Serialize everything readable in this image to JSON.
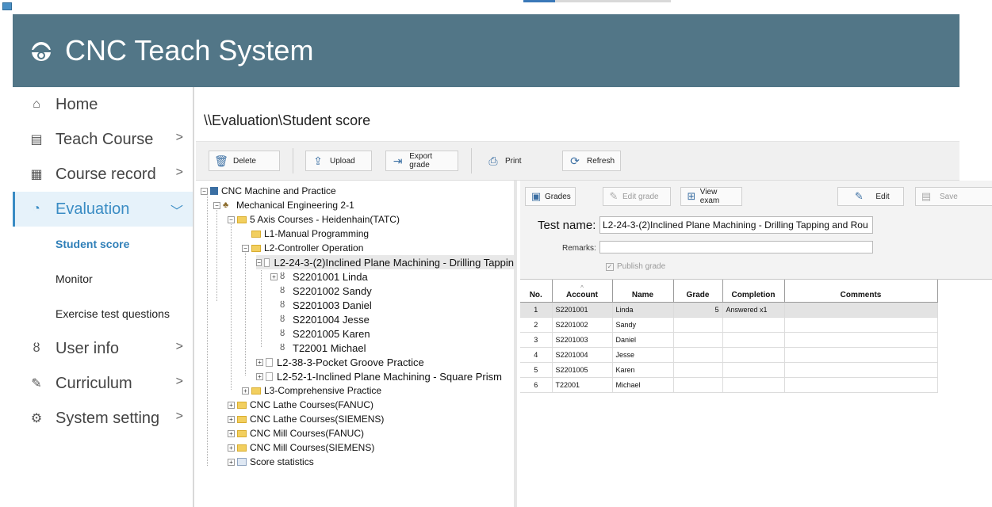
{
  "app": {
    "title": "CNC Teach System",
    "logo_icon": "hardhat-gear-icon"
  },
  "sidebar": {
    "items": [
      {
        "label": "Home",
        "icon": "home-icon",
        "has_arrow": false
      },
      {
        "label": "Teach Course",
        "icon": "monitor-icon",
        "has_arrow": true
      },
      {
        "label": "Course record",
        "icon": "document-icon",
        "has_arrow": true
      },
      {
        "label": "Evaluation",
        "icon": "pie-chart-icon",
        "has_arrow": true,
        "active": true
      },
      {
        "label": "User info",
        "icon": "user-icon",
        "has_arrow": true
      },
      {
        "label": "Curriculum",
        "icon": "pencil-icon",
        "has_arrow": true
      },
      {
        "label": "System setting",
        "icon": "gear-icon",
        "has_arrow": true
      }
    ],
    "sub_items": [
      {
        "label": "Student score",
        "active": true
      },
      {
        "label": "Monitor"
      },
      {
        "label": "Exercise test questions"
      }
    ],
    "arrow_right": ">",
    "arrow_down": "﹀"
  },
  "main": {
    "breadcrumb": "\\\\Evaluation\\Student score",
    "toolbar": {
      "delete": "Delete",
      "upload": "Upload",
      "export": "Export grade",
      "print": "Print",
      "refresh": "Refresh"
    }
  },
  "tree": {
    "nodes": [
      "CNC Machine and Practice",
      "Mechanical Engineering 2-1",
      "5 Axis Courses - Heidenhain(TATC)",
      "L1-Manual Programming",
      "L2-Controller Operation",
      "L2-24-3-(2)Inclined Plane Machining - Drilling Tappin",
      "S2201001 Linda",
      "S2201002 Sandy",
      "S2201003 Daniel",
      "S2201004 Jesse",
      "S2201005 Karen",
      "T22001 Michael",
      "L2-38-3-Pocket Groove Practice",
      "L2-52-1-Inclined Plane Machining - Square Prism",
      "L3-Comprehensive Practice",
      "CNC Lathe Courses(FANUC)",
      "CNC Lathe Courses(SIEMENS)",
      "CNC Mill Courses(FANUC)",
      "CNC Mill Courses(SIEMENS)",
      "Score statistics"
    ]
  },
  "detail": {
    "toolbar": {
      "grades": "Grades",
      "edit_grade": "Edit grade",
      "view_exam": "View exam",
      "edit": "Edit",
      "save": "Save"
    },
    "test_name_label": "Test name:",
    "test_name_value": "L2-24-3-(2)Inclined Plane Machining - Drilling Tapping and Rou",
    "remarks_label": "Remarks:",
    "remarks_value": "",
    "publish_label": "Publish grade",
    "publish_checked": true
  },
  "grid": {
    "columns": [
      "No.",
      "Account",
      "Name",
      "Grade",
      "Completion",
      "Comments"
    ],
    "rows": [
      {
        "no": "1",
        "account": "S2201001",
        "name": "Linda",
        "grade": "5",
        "completion": "Answered x1",
        "comments": ""
      },
      {
        "no": "2",
        "account": "S2201002",
        "name": "Sandy",
        "grade": "",
        "completion": "",
        "comments": ""
      },
      {
        "no": "3",
        "account": "S2201003",
        "name": "Daniel",
        "grade": "",
        "completion": "",
        "comments": ""
      },
      {
        "no": "4",
        "account": "S2201004",
        "name": "Jesse",
        "grade": "",
        "completion": "",
        "comments": ""
      },
      {
        "no": "5",
        "account": "S2201005",
        "name": "Karen",
        "grade": "",
        "completion": "",
        "comments": ""
      },
      {
        "no": "6",
        "account": "T22001",
        "name": "Michael",
        "grade": "",
        "completion": "",
        "comments": ""
      }
    ]
  },
  "colors": {
    "header_bg": "#527687",
    "accent": "#3a8cc4",
    "active_bg": "#e6f2fa"
  }
}
